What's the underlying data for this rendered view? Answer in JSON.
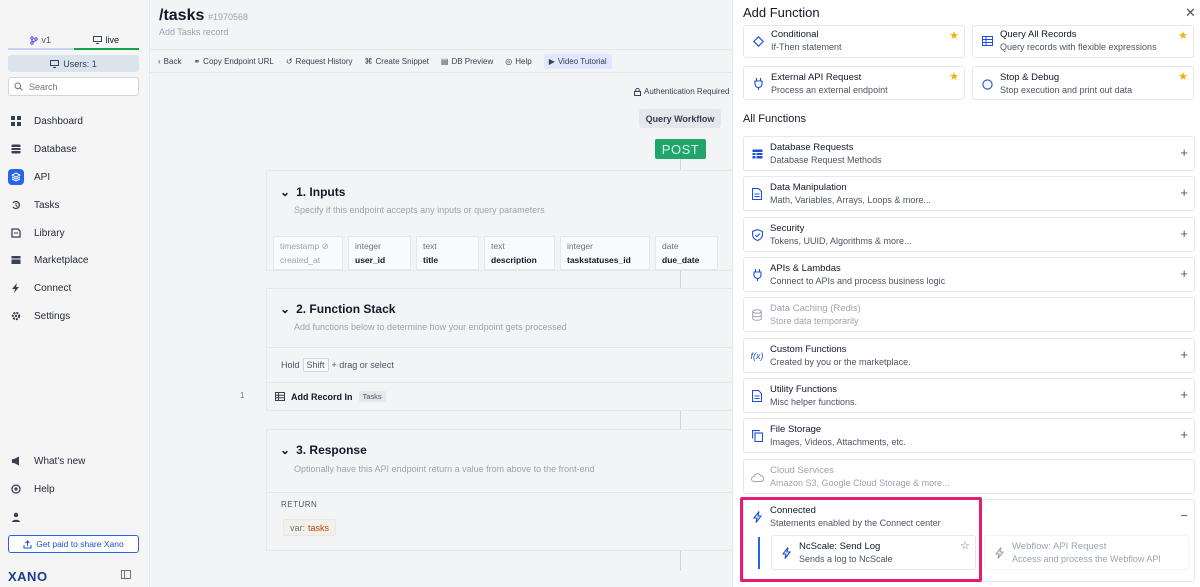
{
  "sidebar": {
    "branch_tabs": [
      "v1",
      "live"
    ],
    "users": "Users: 1",
    "search_placeholder": "Search",
    "nav": [
      {
        "label": "Dashboard",
        "icon": "dashboard-icon"
      },
      {
        "label": "Database",
        "icon": "database-icon"
      },
      {
        "label": "API",
        "icon": "api-icon"
      },
      {
        "label": "Tasks",
        "icon": "tasks-icon"
      },
      {
        "label": "Library",
        "icon": "library-icon"
      },
      {
        "label": "Marketplace",
        "icon": "marketplace-icon"
      },
      {
        "label": "Connect",
        "icon": "connect-icon"
      },
      {
        "label": "Settings",
        "icon": "settings-icon"
      }
    ],
    "bottom_nav": [
      {
        "label": "What's new",
        "icon": "megaphone-icon"
      },
      {
        "label": "Help",
        "icon": "help-icon"
      }
    ],
    "share": "Get paid to share Xano",
    "logo": "XANO"
  },
  "main": {
    "title": "/tasks",
    "id": "#1970568",
    "subtitle": "Add Tasks record",
    "toolbar": [
      "Back",
      "Copy Endpoint URL",
      "Request History",
      "Create Snippet",
      "DB Preview",
      "Help",
      "Video Tutorial"
    ],
    "auth": "Authentication Required",
    "query_workflow": "Query Workflow",
    "method": "POST",
    "inputs": {
      "title": "1. Inputs",
      "subtitle": "Specify if this endpoint accepts any inputs or query parameters",
      "fields": [
        {
          "type": "timestamp",
          "name": "created_at"
        },
        {
          "type": "integer",
          "name": "user_id"
        },
        {
          "type": "text",
          "name": "title"
        },
        {
          "type": "text",
          "name": "description"
        },
        {
          "type": "integer",
          "name": "taskstatuses_id"
        },
        {
          "type": "date",
          "name": "due_date"
        }
      ]
    },
    "stack": {
      "title": "2. Function Stack",
      "subtitle": "Add functions below to determine how your endpoint gets processed",
      "hold": "Hold",
      "shift": "Shift",
      "hold_rest": "+ drag or select",
      "line": "1",
      "record": "Add Record In",
      "record_tag": "Tasks"
    },
    "response": {
      "title": "3. Response",
      "subtitle": "Optionally have this API endpoint return a value from above to the front-end",
      "return_label": "RETURN",
      "var_prefix": "var:",
      "var_name": "tasks"
    }
  },
  "panel": {
    "title": "Add Function",
    "favorites": [
      {
        "name": "Conditional",
        "desc": "If-Then statement",
        "icon": "diamond-icon"
      },
      {
        "name": "Query All Records",
        "desc": "Query records with flexible expressions",
        "icon": "table-icon"
      },
      {
        "name": "External API Request",
        "desc": "Process an external endpoint",
        "icon": "plug-icon"
      },
      {
        "name": "Stop & Debug",
        "desc": "Stop execution and print out data",
        "icon": "circle-icon"
      }
    ],
    "all_title": "All Functions",
    "functions": [
      {
        "name": "Database Requests",
        "desc": "Database Request Methods"
      },
      {
        "name": "Data Manipulation",
        "desc": "Math, Variables, Arrays, Loops & more..."
      },
      {
        "name": "Security",
        "desc": "Tokens, UUID, Algorithms & more..."
      },
      {
        "name": "APIs & Lambdas",
        "desc": "Connect to APIs and process business logic"
      },
      {
        "name": "Data Caching (Redis)",
        "desc": "Store data temporarily"
      },
      {
        "name": "Custom Functions",
        "desc": "Created by you or the marketplace."
      },
      {
        "name": "Utility Functions",
        "desc": "Misc helper functions."
      },
      {
        "name": "File Storage",
        "desc": "Images, Videos, Attachments, etc."
      },
      {
        "name": "Cloud Services",
        "desc": "Amazon S3, Google Cloud Storage & more..."
      },
      {
        "name": "Connected",
        "desc": "Statements enabled by the Connect center"
      }
    ],
    "connected_items": [
      {
        "name": "NcScale: Send Log",
        "desc": "Sends a log to NcScale"
      },
      {
        "name": "Webflow: API Request",
        "desc": "Access and process the Webflow API"
      }
    ],
    "colors": {
      "accent": "#2563eb",
      "highlight": "#e11d74",
      "star": "#eab308",
      "post": "#22a56a"
    }
  }
}
